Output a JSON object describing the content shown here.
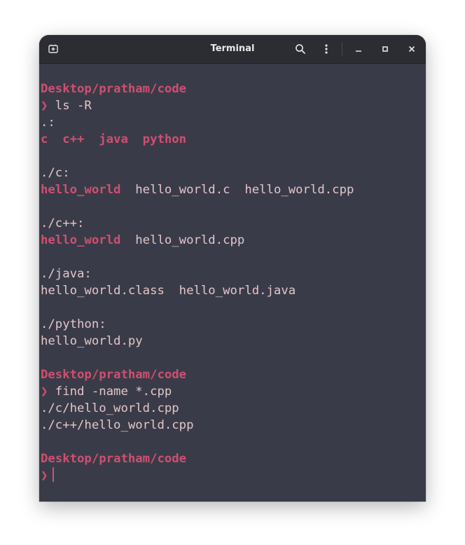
{
  "window": {
    "title": "Terminal",
    "new_tab_icon": "new-tab-icon",
    "search_icon": "search-icon",
    "menu_icon": "kebab-menu-icon",
    "minimize_icon": "minimize-icon",
    "maximize_icon": "maximize-icon",
    "close_icon": "close-icon"
  },
  "colors": {
    "background": "#393c48",
    "titlebar": "#2b2d32",
    "accent": "#d14e72",
    "text": "#e4c4ca"
  },
  "prompt_symbol": "❯",
  "lines": [
    {
      "spans": [
        {
          "text": "Desktop/pratham/code",
          "style": "accent"
        }
      ]
    },
    {
      "spans": [
        {
          "text": "❯",
          "style": "accent"
        },
        {
          "text": " ls -R",
          "style": "plain"
        }
      ]
    },
    {
      "spans": [
        {
          "text": ".:",
          "style": "plain"
        }
      ]
    },
    {
      "spans": [
        {
          "text": "c  c++  java  python",
          "style": "accent"
        }
      ]
    },
    {
      "spans": []
    },
    {
      "spans": [
        {
          "text": "./c:",
          "style": "plain"
        }
      ]
    },
    {
      "spans": [
        {
          "text": "hello_world",
          "style": "accent"
        },
        {
          "text": "  hello_world.c  hello_world.cpp",
          "style": "plain"
        }
      ]
    },
    {
      "spans": []
    },
    {
      "spans": [
        {
          "text": "./c++:",
          "style": "plain"
        }
      ]
    },
    {
      "spans": [
        {
          "text": "hello_world",
          "style": "accent"
        },
        {
          "text": "  hello_world.cpp",
          "style": "plain"
        }
      ]
    },
    {
      "spans": []
    },
    {
      "spans": [
        {
          "text": "./java:",
          "style": "plain"
        }
      ]
    },
    {
      "spans": [
        {
          "text": "hello_world.class  hello_world.java",
          "style": "plain"
        }
      ]
    },
    {
      "spans": []
    },
    {
      "spans": [
        {
          "text": "./python:",
          "style": "plain"
        }
      ]
    },
    {
      "spans": [
        {
          "text": "hello_world.py",
          "style": "plain"
        }
      ]
    },
    {
      "spans": []
    },
    {
      "spans": [
        {
          "text": "Desktop/pratham/code",
          "style": "accent"
        }
      ]
    },
    {
      "spans": [
        {
          "text": "❯",
          "style": "accent"
        },
        {
          "text": " find -name *.cpp",
          "style": "plain"
        }
      ]
    },
    {
      "spans": [
        {
          "text": "./c/hello_world.cpp",
          "style": "plain"
        }
      ]
    },
    {
      "spans": [
        {
          "text": "./c++/hello_world.cpp",
          "style": "plain"
        }
      ]
    },
    {
      "spans": []
    },
    {
      "spans": [
        {
          "text": "Desktop/pratham/code",
          "style": "accent"
        }
      ]
    },
    {
      "spans": [
        {
          "text": "❯",
          "style": "accent"
        }
      ],
      "cursor": true
    }
  ]
}
